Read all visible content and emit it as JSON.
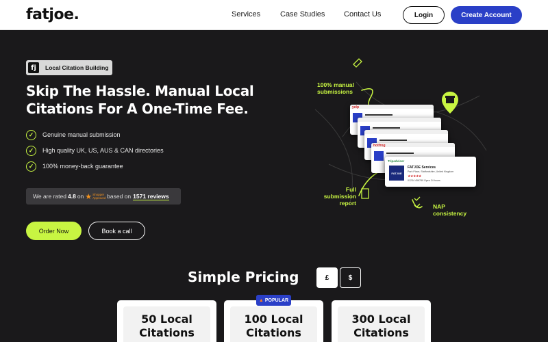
{
  "nav": {
    "logo": "fatjoe.",
    "links": [
      "Services",
      "Case Studies",
      "Contact Us"
    ],
    "login": "Login",
    "create_account": "Create Account"
  },
  "hero": {
    "badge_icon": "fj",
    "badge": "Local Citation Building",
    "title": "Skip The Hassle. Manual Local Citations For A One-Time Fee.",
    "features": [
      "Genuine manual submission",
      "High quality UK, US, AUS & CAN directories",
      "100% money-back guarantee"
    ],
    "rating": {
      "prefix": "We are rated",
      "score": "4.8",
      "on": "on",
      "platform_top": "Shopper",
      "platform_bottom": "Approved",
      "based_on": "based on",
      "reviews": "1571 reviews"
    },
    "order_button": "Order Now",
    "call_button": "Book a call"
  },
  "illustration": {
    "label_submissions_1": "100% manual",
    "label_submissions_2": "submissions",
    "label_report_1": "Full",
    "label_report_2": "submission",
    "label_report_3": "report",
    "label_nap_1": "NAP",
    "label_nap_2": "consistency",
    "card_sites": [
      "yelp",
      "",
      "",
      "hotfrog",
      "Tripadvisor"
    ],
    "main_card": {
      "top": "Tripadvisor",
      "logo": "FATJOE",
      "name": "FATJOE Services",
      "address": "Park Place, Staffordshire, United Kingdom",
      "stars": "★★★★★",
      "phone": "01234 456789     Open 24 hours"
    },
    "accent_color": "#c8f542"
  },
  "pricing": {
    "title": "Simple Pricing",
    "currency_gbp": "£",
    "currency_usd": "$",
    "popular_badge": "POPULAR",
    "plans": [
      {
        "line1": "50 Local",
        "line2": "Citations"
      },
      {
        "line1": "100 Local",
        "line2": "Citations"
      },
      {
        "line1": "300 Local",
        "line2": "Citations"
      }
    ]
  },
  "colors": {
    "background": "#1a191b",
    "brand_blue": "#2a3fc7",
    "lime": "#c8f542"
  }
}
